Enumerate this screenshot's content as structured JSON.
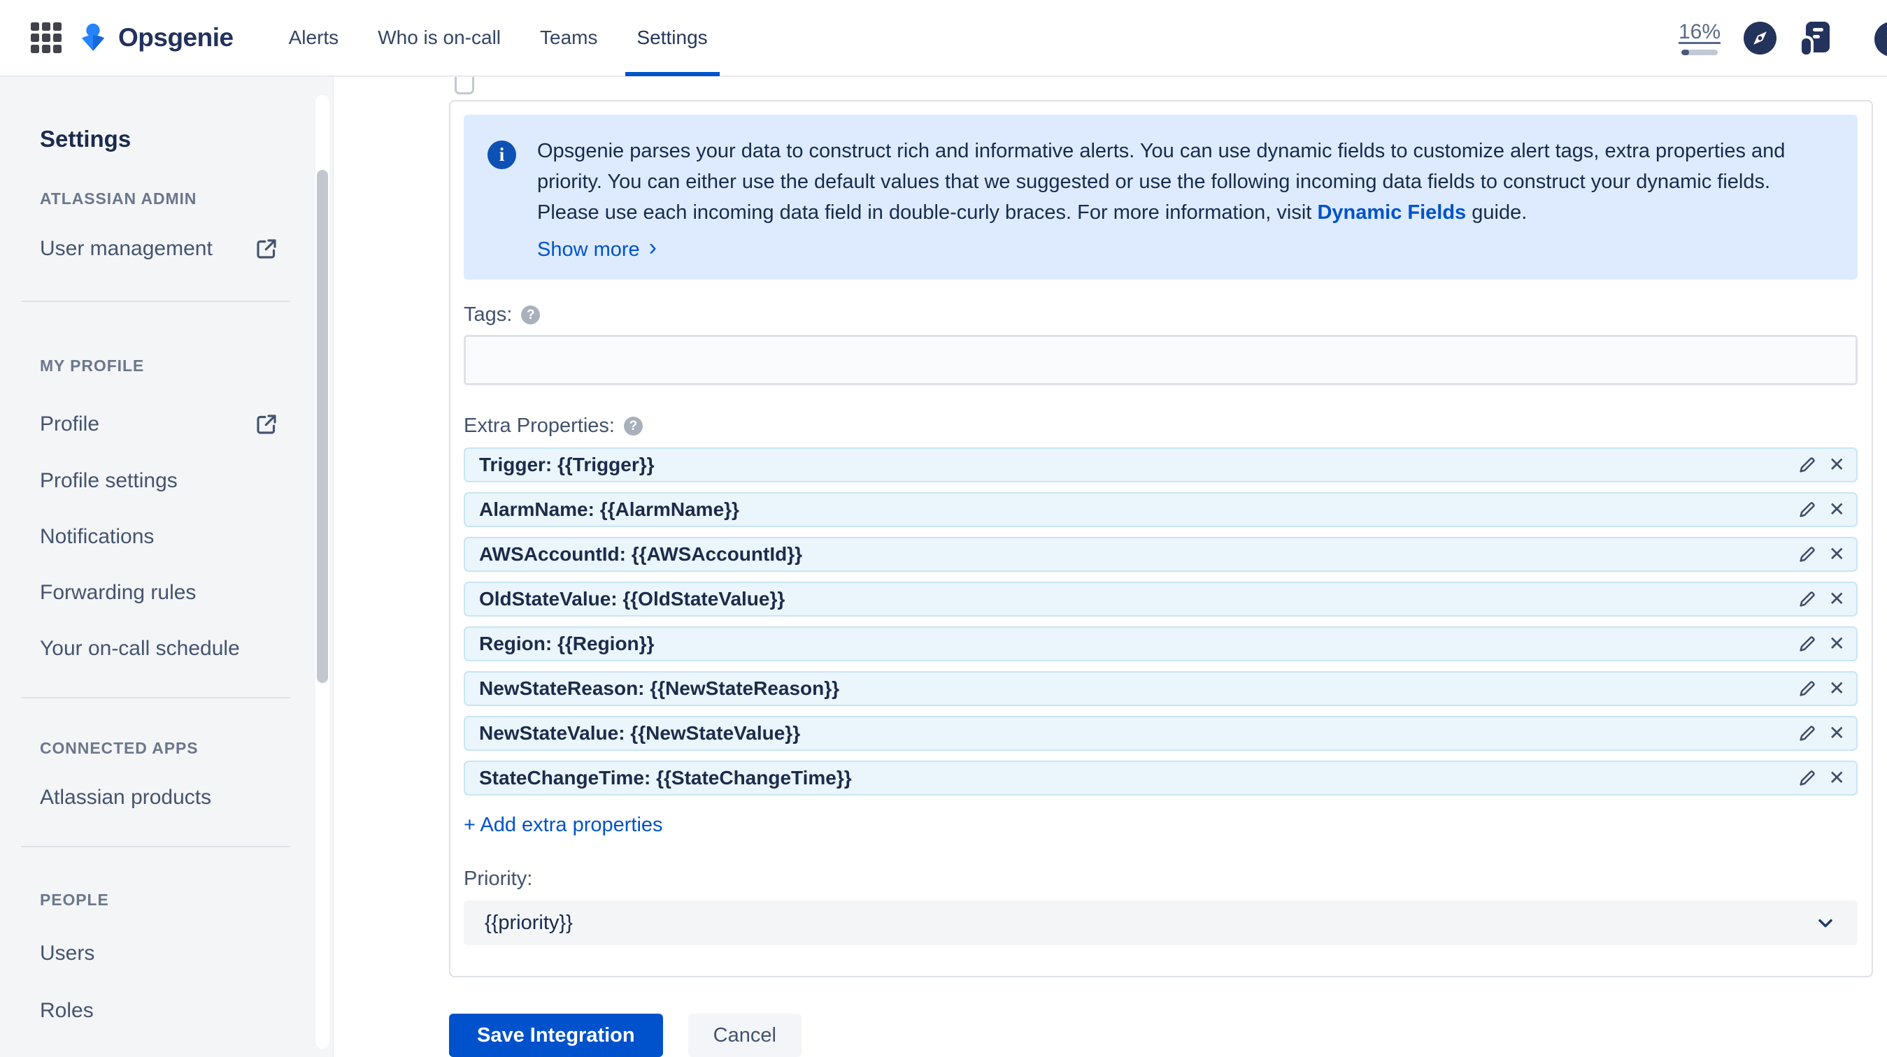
{
  "header": {
    "app_name": "Opsgenie",
    "nav": [
      {
        "label": "Alerts"
      },
      {
        "label": "Who is on-call"
      },
      {
        "label": "Teams"
      },
      {
        "label": "Settings"
      }
    ],
    "usage_percent": "16%",
    "help_glyph": "?"
  },
  "sidebar": {
    "heading": "Settings",
    "sections": [
      {
        "label": "ATLASSIAN ADMIN",
        "items": [
          {
            "label": "User management"
          }
        ]
      },
      {
        "label": "MY PROFILE",
        "items": [
          {
            "label": "Profile"
          },
          {
            "label": "Profile settings"
          },
          {
            "label": "Notifications"
          },
          {
            "label": "Forwarding rules"
          },
          {
            "label": "Your on-call schedule"
          }
        ]
      },
      {
        "label": "CONNECTED APPS",
        "items": [
          {
            "label": "Atlassian products"
          }
        ]
      },
      {
        "label": "PEOPLE",
        "items": [
          {
            "label": "Users"
          },
          {
            "label": "Roles"
          }
        ]
      }
    ]
  },
  "main": {
    "info_banner": {
      "icon_glyph": "i",
      "text_before_link": "Opsgenie parses your data to construct rich and informative alerts. You can use dynamic fields to customize alert tags, extra properties and priority. You can either use the default values that we suggested or use the following incoming data fields to construct your dynamic fields. Please use each incoming data field in double-curly braces. For more information, visit ",
      "link_label": "Dynamic Fields",
      "text_after_link": " guide.",
      "show_more_label": "Show more",
      "show_more_chevron": "›"
    },
    "tags": {
      "label": "Tags:",
      "value": ""
    },
    "extra_properties": {
      "label": "Extra Properties:",
      "rows": [
        "Trigger: {{Trigger}}",
        "AlarmName: {{AlarmName}}",
        "AWSAccountId: {{AWSAccountId}}",
        "OldStateValue: {{OldStateValue}}",
        "Region: {{Region}}",
        "NewStateReason: {{NewStateReason}}",
        "NewStateValue: {{NewStateValue}}",
        "StateChangeTime: {{StateChangeTime}}"
      ],
      "add_label": "+ Add extra properties",
      "delete_glyph": "✕"
    },
    "priority": {
      "label": "Priority:",
      "value": "{{priority}}"
    },
    "actions": {
      "save_label": "Save Integration",
      "cancel_label": "Cancel"
    },
    "help_glyph": "?"
  },
  "colors": {
    "accent": "#0052CC",
    "banner_bg": "#DEEBFF",
    "row_bg": "#EAF5FC",
    "navy": "#24335B"
  }
}
